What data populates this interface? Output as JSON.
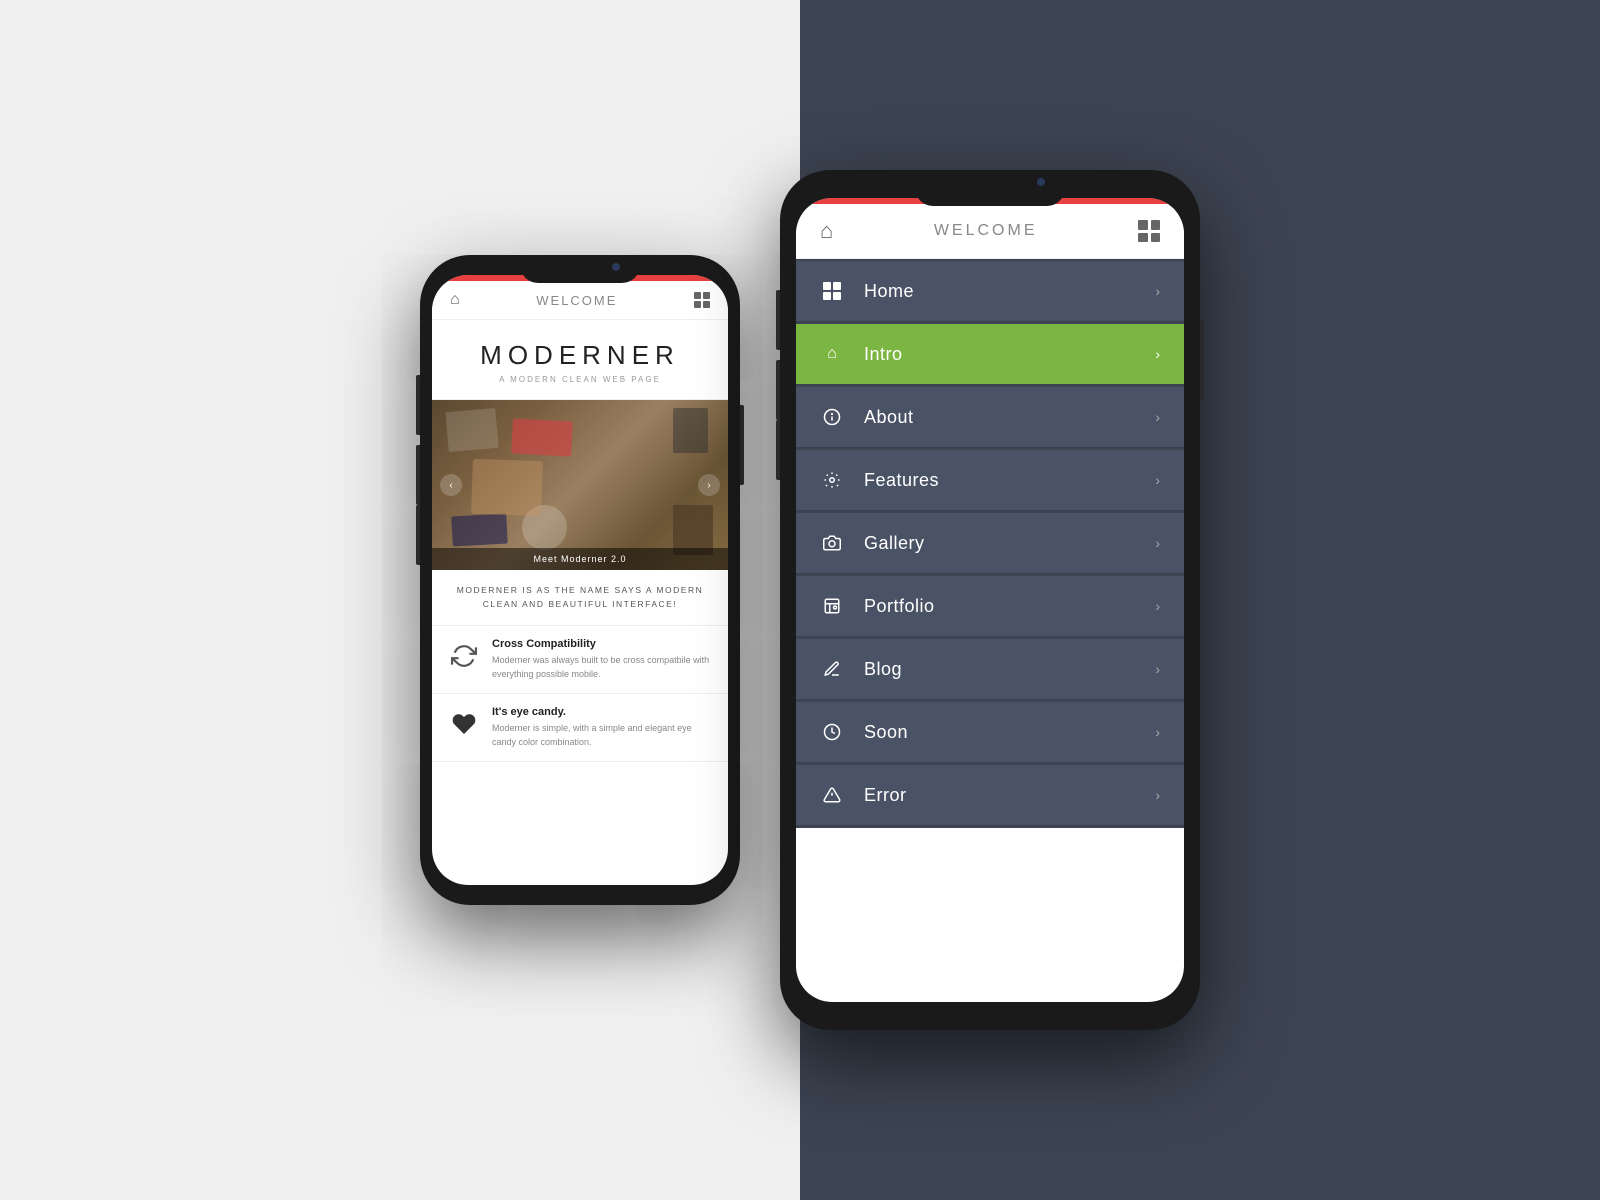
{
  "scene": {
    "bg_left": "#f0f0f0",
    "bg_right": "#3d4452"
  },
  "phone_left": {
    "header": {
      "title": "WELCOME",
      "home_icon": "🏠",
      "grid_icon": "grid"
    },
    "brand": {
      "name": "MODERNER",
      "tagline": "A MODERN CLEAN WEB PAGE"
    },
    "carousel": {
      "caption": "Meet Moderner 2.0"
    },
    "description": "MODERNER IS AS THE NAME SAYS A\nMODERN CLEAN AND BEAUTIFUL INTERFACE!",
    "features": [
      {
        "id": "cross-compat",
        "icon": "sync",
        "title": "Cross Compatibility",
        "body": "Moderner was always built to be cross compatbile with everything possible mobile."
      },
      {
        "id": "eye-candy",
        "icon": "heart",
        "title": "It's eye candy.",
        "body": "Moderner is simple, with a simple and elegant eye candy color combination."
      }
    ]
  },
  "phone_right": {
    "header": {
      "title": "WELCOME",
      "home_icon": "🏠",
      "grid_icon": "grid"
    },
    "nav_items": [
      {
        "id": "home",
        "icon": "grid",
        "label": "Home",
        "active": false
      },
      {
        "id": "intro",
        "icon": "home",
        "label": "Intro",
        "active": true
      },
      {
        "id": "about",
        "icon": "info",
        "label": "About",
        "active": false
      },
      {
        "id": "features",
        "icon": "gear",
        "label": "Features",
        "active": false
      },
      {
        "id": "gallery",
        "icon": "camera",
        "label": "Gallery",
        "active": false
      },
      {
        "id": "portfolio",
        "icon": "image",
        "label": "Portfolio",
        "active": false
      },
      {
        "id": "blog",
        "icon": "pencil",
        "label": "Blog",
        "active": false
      },
      {
        "id": "soon",
        "icon": "clock",
        "label": "Soon",
        "active": false
      },
      {
        "id": "error",
        "icon": "warn",
        "label": "Error",
        "active": false
      }
    ]
  },
  "colors": {
    "red_bar": "#e84040",
    "active_green": "#7cb642",
    "nav_bg": "#4a5265",
    "dark_bg": "#3d4452"
  }
}
